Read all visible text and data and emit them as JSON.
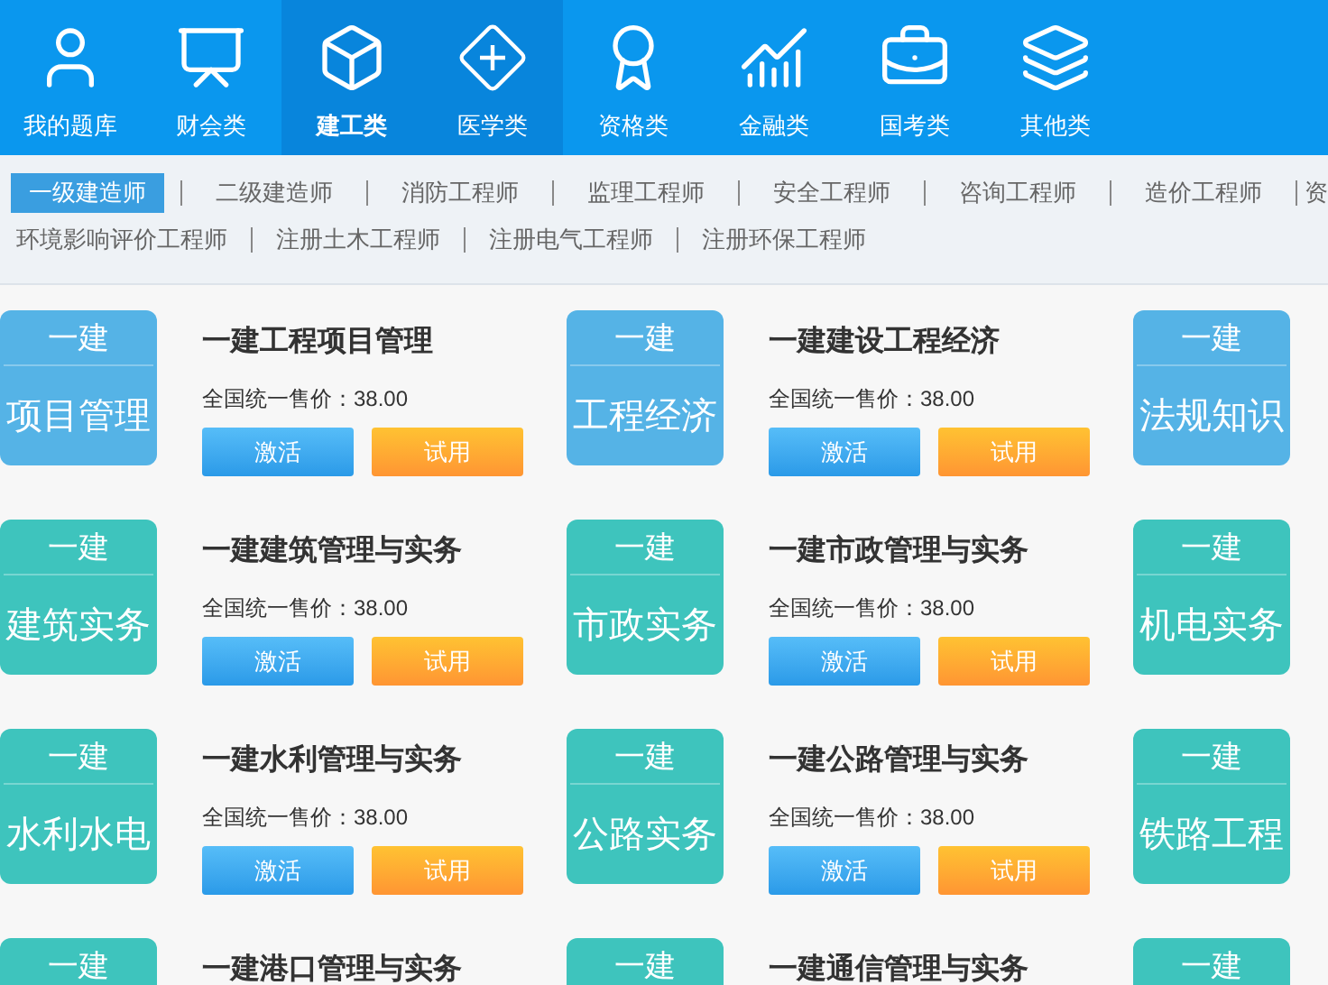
{
  "nav": [
    {
      "label": "我的题库",
      "selected": false,
      "hovered": false
    },
    {
      "label": "财会类",
      "selected": false,
      "hovered": false
    },
    {
      "label": "建工类",
      "selected": true,
      "hovered": false
    },
    {
      "label": "医学类",
      "selected": false,
      "hovered": true
    },
    {
      "label": "资格类",
      "selected": false,
      "hovered": false
    },
    {
      "label": "金融类",
      "selected": false,
      "hovered": false
    },
    {
      "label": "国考类",
      "selected": false,
      "hovered": false
    },
    {
      "label": "其他类",
      "selected": false,
      "hovered": false
    }
  ],
  "subnav": [
    [
      {
        "label": "一级建造师",
        "selected": true
      },
      {
        "label": "二级建造师",
        "selected": false
      },
      {
        "label": "消防工程师",
        "selected": false
      },
      {
        "label": "监理工程师",
        "selected": false
      },
      {
        "label": "安全工程师",
        "selected": false
      },
      {
        "label": "咨询工程师",
        "selected": false
      },
      {
        "label": "造价工程师",
        "selected": false
      },
      {
        "label": "资",
        "selected": false
      }
    ],
    [
      {
        "label": "环境影响评价工程师",
        "selected": false
      },
      {
        "label": "注册土木工程师",
        "selected": false
      },
      {
        "label": "注册电气工程师",
        "selected": false
      },
      {
        "label": "注册环保工程师",
        "selected": false
      }
    ]
  ],
  "courses": [
    [
      {
        "tile_top": "一建",
        "tile_name": "项目管理",
        "color": "#55b3e6",
        "title": "一建工程项目管理",
        "price": "全国统一售价：38.00",
        "activate": "激活",
        "trial": "试用"
      },
      {
        "tile_top": "一建",
        "tile_name": "工程经济",
        "color": "#55b3e6",
        "title": "一建建设工程经济",
        "price": "全国统一售价：38.00",
        "activate": "激活",
        "trial": "试用"
      },
      {
        "tile_top": "一建",
        "tile_name": "法规知识",
        "color": "#55b3e6"
      }
    ],
    [
      {
        "tile_top": "一建",
        "tile_name": "建筑实务",
        "color": "#3ec4bd",
        "title": "一建建筑管理与实务",
        "price": "全国统一售价：38.00",
        "activate": "激活",
        "trial": "试用"
      },
      {
        "tile_top": "一建",
        "tile_name": "市政实务",
        "color": "#3ec4bd",
        "title": "一建市政管理与实务",
        "price": "全国统一售价：38.00",
        "activate": "激活",
        "trial": "试用"
      },
      {
        "tile_top": "一建",
        "tile_name": "机电实务",
        "color": "#3ec4bd"
      }
    ],
    [
      {
        "tile_top": "一建",
        "tile_name": "水利水电",
        "color": "#3ec4bd",
        "title": "一建水利管理与实务",
        "price": "全国统一售价：38.00",
        "activate": "激活",
        "trial": "试用"
      },
      {
        "tile_top": "一建",
        "tile_name": "公路实务",
        "color": "#3ec4bd",
        "title": "一建公路管理与实务",
        "price": "全国统一售价：38.00",
        "activate": "激活",
        "trial": "试用"
      },
      {
        "tile_top": "一建",
        "tile_name": "铁路工程",
        "color": "#3ec4bd"
      }
    ],
    [
      {
        "tile_top": "一建",
        "color": "#3ec4bd",
        "title": "一建港口管理与实务"
      },
      {
        "tile_top": "一建",
        "color": "#3ec4bd",
        "title": "一建通信管理与实务"
      },
      {
        "tile_top": "一建",
        "color": "#3ec4bd"
      }
    ]
  ]
}
